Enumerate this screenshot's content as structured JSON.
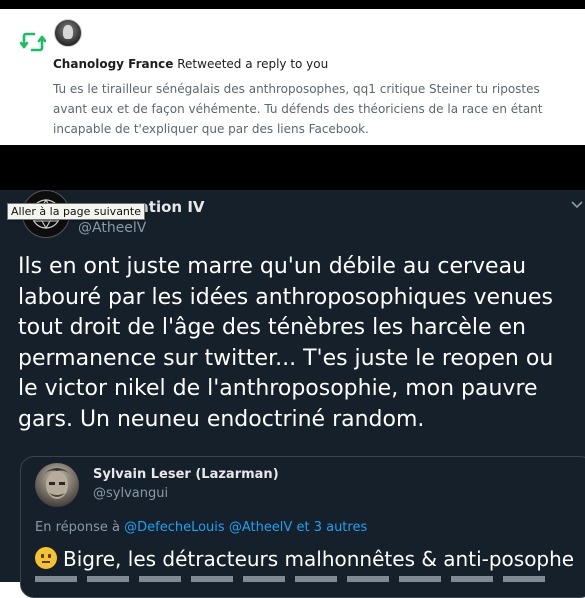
{
  "notification": {
    "icon": "retweet-icon",
    "user_name": "Chanology France",
    "action": "Retweeted a reply to you",
    "reply_lines": [
      "Tu es le tirailleur sénégalais des anthroposophes, qq1 critique Steiner tu ripostes",
      "avant eux et de façon véhémente. Tu défends des théoriciens de la race en étant",
      "incapable de t'expliquer que par des liens Facebook."
    ],
    "accent_color": "#17bf63"
  },
  "tooltip": "Aller à la page suivante",
  "tweet": {
    "name_visible": "uation IV",
    "handle": "@AtheelV",
    "body_lines": [
      "Ils en ont juste marre qu'un débile au cerveau",
      "labouré par les idées anthroposophiques venues",
      "tout droit de l'âge des ténèbres les harcèle en",
      "permanence sur twitter... T'es juste le reopen ou",
      "le victor nikel de l'anthroposophie, mon pauvre",
      "gars. Un neuneu endoctriné random."
    ],
    "background": "#15202b"
  },
  "quoted": {
    "name": "Sylvain Leser (Lazarman)",
    "handle": "@sylvangui",
    "reply_prefix": "En réponse à",
    "mention_1": "@DefecheLouis",
    "mention_2": "@AtheelV",
    "reply_suffix": "et 3 autres",
    "text": "Bigre, les détracteurs malhonnêtes & anti-posophe",
    "emoji": "neutral-face-emoji"
  }
}
